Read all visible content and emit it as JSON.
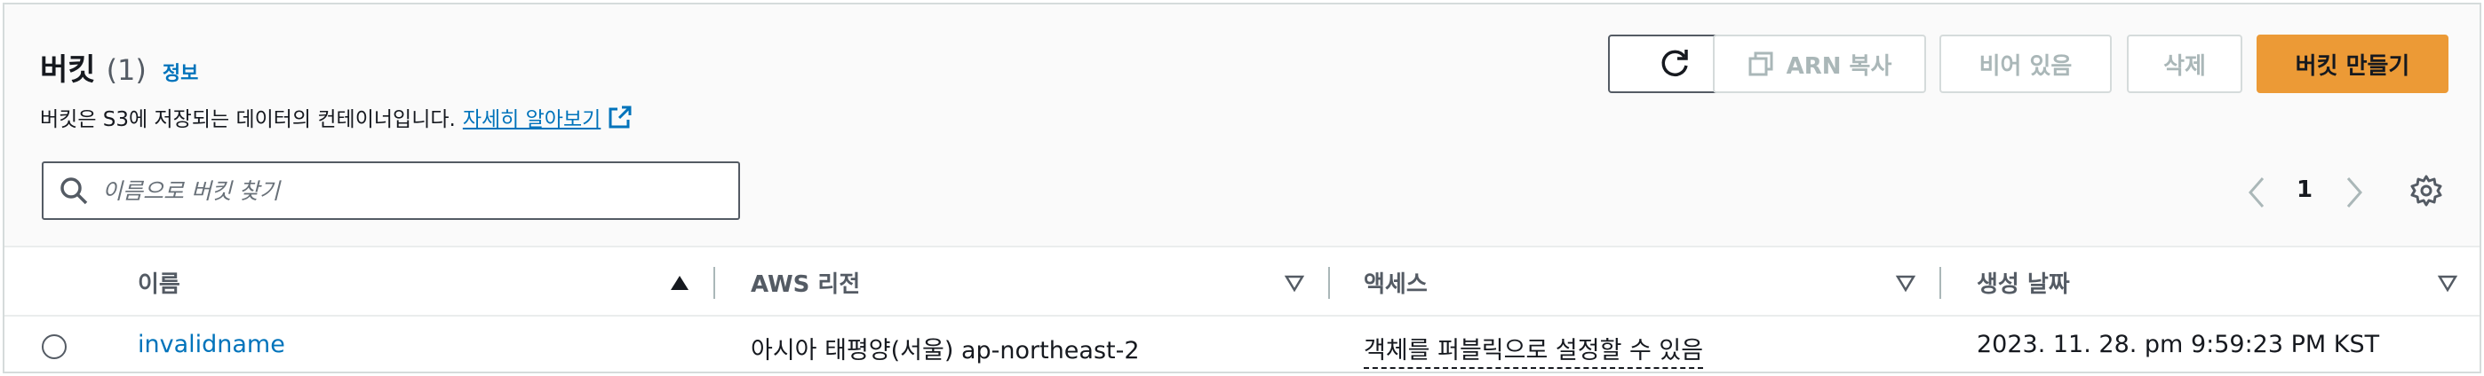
{
  "header": {
    "title": "버킷",
    "count": "(1)",
    "info_link": "정보",
    "description": "버킷은 S3에 저장되는 데이터의 컨테이너입니다.",
    "learn_more": "자세히 알아보기"
  },
  "toolbar": {
    "arn_copy": "ARN 복사",
    "empty": "비어 있음",
    "delete": "삭제",
    "create": "버킷 만들기"
  },
  "search": {
    "placeholder": "이름으로 버킷 찾기"
  },
  "pagination": {
    "current_page": "1"
  },
  "table": {
    "columns": [
      "이름",
      "AWS 리전",
      "액세스",
      "생성 날짜"
    ],
    "rows": [
      {
        "name": "invalidname",
        "region": "아시아 태평양(서울) ap-northeast-2",
        "access": "객체를 퍼블릭으로 설정할 수 있음",
        "created": "2023. 11. 28. pm 9:59:23 PM KST"
      }
    ]
  },
  "colors": {
    "accent": "#ec9a36",
    "link": "#0073bb",
    "text": "#16191f",
    "muted": "#545b64",
    "disabled": "#aab7b8",
    "border": "#d5dbdb",
    "background": "#fafafa"
  },
  "icons": [
    "refresh-icon",
    "copy-icon",
    "external-link-icon",
    "search-icon",
    "chevron-left-icon",
    "chevron-right-icon",
    "gear-icon",
    "sort-ascending-icon",
    "sort-descending-icon"
  ]
}
